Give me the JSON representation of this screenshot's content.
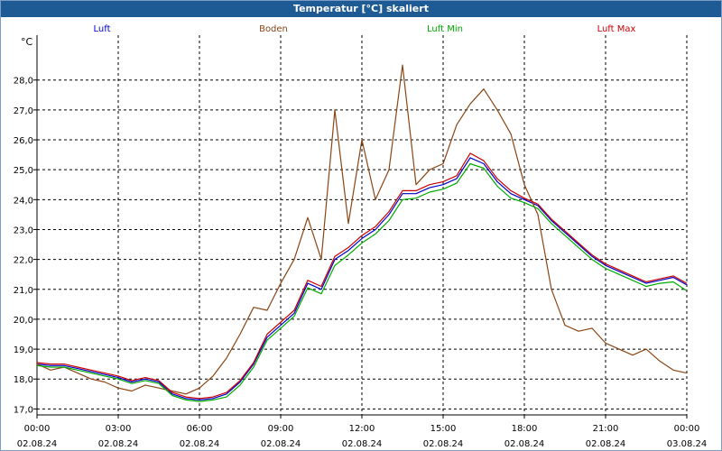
{
  "window": {
    "title": "Temperatur [°C] skaliert"
  },
  "chart_data": {
    "type": "line",
    "title": "Temperatur [°C] skaliert",
    "ylabel": "°C",
    "xlabel": "",
    "ylim": [
      16.8,
      29.5
    ],
    "xlim": [
      0,
      24
    ],
    "grid": true,
    "legend_position": "top",
    "y_ticks": [
      "17,0",
      "18,0",
      "19,0",
      "20,0",
      "21,0",
      "22,0",
      "23,0",
      "24,0",
      "25,0",
      "26,0",
      "27,0",
      "28,0"
    ],
    "x_ticks": [
      {
        "time": "00:00",
        "date": "02.08.24"
      },
      {
        "time": "03:00",
        "date": "02.08.24"
      },
      {
        "time": "06:00",
        "date": "02.08.24"
      },
      {
        "time": "09:00",
        "date": "02.08.24"
      },
      {
        "time": "12:00",
        "date": "02.08.24"
      },
      {
        "time": "15:00",
        "date": "02.08.24"
      },
      {
        "time": "18:00",
        "date": "02.08.24"
      },
      {
        "time": "21:00",
        "date": "02.08.24"
      },
      {
        "time": "00:00",
        "date": "03.08.24"
      }
    ],
    "series": [
      {
        "name": "Luft",
        "color": "#0000cc",
        "x": [
          0,
          0.5,
          1,
          1.5,
          2,
          2.5,
          3,
          3.5,
          4,
          4.5,
          5,
          5.5,
          6,
          6.5,
          7,
          7.5,
          8,
          8.5,
          9,
          9.5,
          10,
          10.5,
          11,
          11.5,
          12,
          12.5,
          13,
          13.5,
          14,
          14.5,
          15,
          15.5,
          16,
          16.5,
          17,
          17.5,
          18,
          18.5,
          19,
          19.5,
          20,
          20.5,
          21,
          21.5,
          22,
          22.5,
          23,
          23.5,
          24
        ],
        "values": [
          18.5,
          18.45,
          18.45,
          18.35,
          18.25,
          18.15,
          18.05,
          17.9,
          18.0,
          17.9,
          17.5,
          17.35,
          17.3,
          17.35,
          17.5,
          17.9,
          18.5,
          19.4,
          19.8,
          20.2,
          21.2,
          21.0,
          22.0,
          22.3,
          22.7,
          23.0,
          23.5,
          24.2,
          24.2,
          24.4,
          24.5,
          24.7,
          25.4,
          25.2,
          24.6,
          24.2,
          24.0,
          23.8,
          23.3,
          22.9,
          22.5,
          22.1,
          21.8,
          21.6,
          21.4,
          21.2,
          21.3,
          21.4,
          21.15
        ]
      },
      {
        "name": "Boden",
        "color": "#8b4513",
        "x": [
          0,
          0.5,
          1,
          1.5,
          2,
          2.5,
          3,
          3.5,
          4,
          4.5,
          5,
          5.5,
          6,
          6.5,
          7,
          7.5,
          8,
          8.5,
          9,
          9.5,
          10,
          10.5,
          11,
          11.5,
          12,
          12.5,
          13,
          13.5,
          14,
          14.5,
          15,
          15.5,
          16,
          16.5,
          17,
          17.5,
          18,
          18.5,
          19,
          19.5,
          20,
          20.5,
          21,
          21.5,
          22,
          22.5,
          23,
          23.5,
          24
        ],
        "values": [
          18.5,
          18.3,
          18.4,
          18.2,
          18.0,
          17.9,
          17.7,
          17.6,
          17.8,
          17.7,
          17.6,
          17.5,
          17.7,
          18.1,
          18.7,
          19.5,
          20.4,
          20.3,
          21.2,
          22.0,
          23.4,
          22.0,
          27.0,
          23.2,
          26.0,
          24.0,
          25.0,
          28.5,
          24.5,
          25.0,
          25.2,
          26.5,
          27.2,
          27.7,
          27.0,
          26.2,
          24.5,
          23.5,
          21.0,
          19.8,
          19.6,
          19.7,
          19.2,
          19.0,
          18.8,
          19.0,
          18.6,
          18.3,
          18.2
        ]
      },
      {
        "name": "Luft Min",
        "color": "#00aa00",
        "x": [
          0,
          0.5,
          1,
          1.5,
          2,
          2.5,
          3,
          3.5,
          4,
          4.5,
          5,
          5.5,
          6,
          6.5,
          7,
          7.5,
          8,
          8.5,
          9,
          9.5,
          10,
          10.5,
          11,
          11.5,
          12,
          12.5,
          13,
          13.5,
          14,
          14.5,
          15,
          15.5,
          16,
          16.5,
          17,
          17.5,
          18,
          18.5,
          19,
          19.5,
          20,
          20.5,
          21,
          21.5,
          22,
          22.5,
          23,
          23.5,
          24
        ],
        "values": [
          18.45,
          18.4,
          18.4,
          18.3,
          18.2,
          18.1,
          18.0,
          17.85,
          17.95,
          17.85,
          17.45,
          17.3,
          17.25,
          17.3,
          17.4,
          17.8,
          18.4,
          19.3,
          19.7,
          20.1,
          21.05,
          20.85,
          21.8,
          22.15,
          22.55,
          22.85,
          23.3,
          24.0,
          24.05,
          24.25,
          24.35,
          24.55,
          25.2,
          25.05,
          24.45,
          24.05,
          23.9,
          23.7,
          23.2,
          22.8,
          22.4,
          22.0,
          21.7,
          21.5,
          21.3,
          21.1,
          21.2,
          21.25,
          20.95
        ]
      },
      {
        "name": "Luft Max",
        "color": "#cc0000",
        "x": [
          0,
          0.5,
          1,
          1.5,
          2,
          2.5,
          3,
          3.5,
          4,
          4.5,
          5,
          5.5,
          6,
          6.5,
          7,
          7.5,
          8,
          8.5,
          9,
          9.5,
          10,
          10.5,
          11,
          11.5,
          12,
          12.5,
          13,
          13.5,
          14,
          14.5,
          15,
          15.5,
          16,
          16.5,
          17,
          17.5,
          18,
          18.5,
          19,
          19.5,
          20,
          20.5,
          21,
          21.5,
          22,
          22.5,
          23,
          23.5,
          24
        ],
        "values": [
          18.55,
          18.5,
          18.5,
          18.4,
          18.3,
          18.2,
          18.1,
          17.95,
          18.05,
          17.95,
          17.55,
          17.4,
          17.35,
          17.4,
          17.55,
          17.95,
          18.55,
          19.5,
          19.9,
          20.3,
          21.3,
          21.1,
          22.1,
          22.4,
          22.8,
          23.1,
          23.6,
          24.3,
          24.3,
          24.5,
          24.6,
          24.8,
          25.55,
          25.3,
          24.7,
          24.3,
          24.05,
          23.85,
          23.35,
          22.95,
          22.55,
          22.15,
          21.85,
          21.65,
          21.45,
          21.25,
          21.35,
          21.45,
          21.2
        ]
      }
    ]
  }
}
